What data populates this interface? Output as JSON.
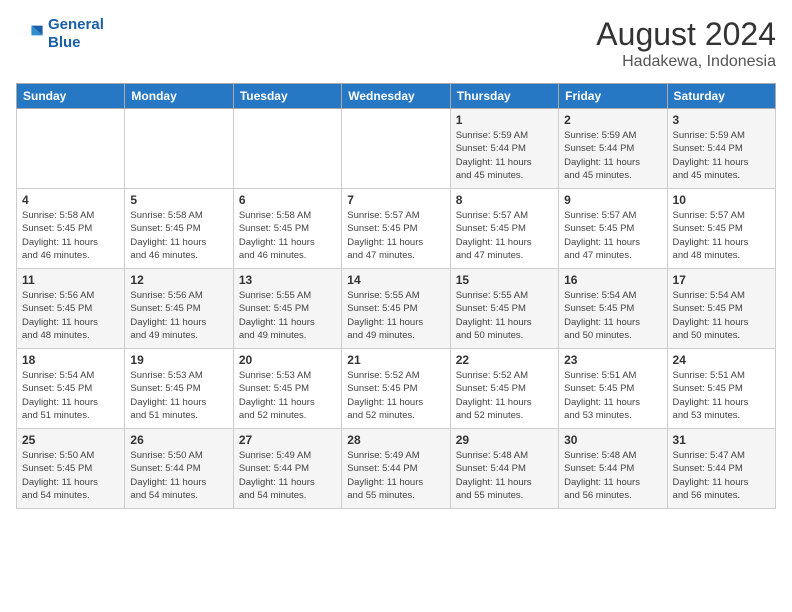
{
  "logo": {
    "line1": "General",
    "line2": "Blue"
  },
  "title": "August 2024",
  "subtitle": "Hadakewa, Indonesia",
  "days_of_week": [
    "Sunday",
    "Monday",
    "Tuesday",
    "Wednesday",
    "Thursday",
    "Friday",
    "Saturday"
  ],
  "weeks": [
    [
      {
        "day": "",
        "info": ""
      },
      {
        "day": "",
        "info": ""
      },
      {
        "day": "",
        "info": ""
      },
      {
        "day": "",
        "info": ""
      },
      {
        "day": "1",
        "info": "Sunrise: 5:59 AM\nSunset: 5:44 PM\nDaylight: 11 hours\nand 45 minutes."
      },
      {
        "day": "2",
        "info": "Sunrise: 5:59 AM\nSunset: 5:44 PM\nDaylight: 11 hours\nand 45 minutes."
      },
      {
        "day": "3",
        "info": "Sunrise: 5:59 AM\nSunset: 5:44 PM\nDaylight: 11 hours\nand 45 minutes."
      }
    ],
    [
      {
        "day": "4",
        "info": "Sunrise: 5:58 AM\nSunset: 5:45 PM\nDaylight: 11 hours\nand 46 minutes."
      },
      {
        "day": "5",
        "info": "Sunrise: 5:58 AM\nSunset: 5:45 PM\nDaylight: 11 hours\nand 46 minutes."
      },
      {
        "day": "6",
        "info": "Sunrise: 5:58 AM\nSunset: 5:45 PM\nDaylight: 11 hours\nand 46 minutes."
      },
      {
        "day": "7",
        "info": "Sunrise: 5:57 AM\nSunset: 5:45 PM\nDaylight: 11 hours\nand 47 minutes."
      },
      {
        "day": "8",
        "info": "Sunrise: 5:57 AM\nSunset: 5:45 PM\nDaylight: 11 hours\nand 47 minutes."
      },
      {
        "day": "9",
        "info": "Sunrise: 5:57 AM\nSunset: 5:45 PM\nDaylight: 11 hours\nand 47 minutes."
      },
      {
        "day": "10",
        "info": "Sunrise: 5:57 AM\nSunset: 5:45 PM\nDaylight: 11 hours\nand 48 minutes."
      }
    ],
    [
      {
        "day": "11",
        "info": "Sunrise: 5:56 AM\nSunset: 5:45 PM\nDaylight: 11 hours\nand 48 minutes."
      },
      {
        "day": "12",
        "info": "Sunrise: 5:56 AM\nSunset: 5:45 PM\nDaylight: 11 hours\nand 49 minutes."
      },
      {
        "day": "13",
        "info": "Sunrise: 5:55 AM\nSunset: 5:45 PM\nDaylight: 11 hours\nand 49 minutes."
      },
      {
        "day": "14",
        "info": "Sunrise: 5:55 AM\nSunset: 5:45 PM\nDaylight: 11 hours\nand 49 minutes."
      },
      {
        "day": "15",
        "info": "Sunrise: 5:55 AM\nSunset: 5:45 PM\nDaylight: 11 hours\nand 50 minutes."
      },
      {
        "day": "16",
        "info": "Sunrise: 5:54 AM\nSunset: 5:45 PM\nDaylight: 11 hours\nand 50 minutes."
      },
      {
        "day": "17",
        "info": "Sunrise: 5:54 AM\nSunset: 5:45 PM\nDaylight: 11 hours\nand 50 minutes."
      }
    ],
    [
      {
        "day": "18",
        "info": "Sunrise: 5:54 AM\nSunset: 5:45 PM\nDaylight: 11 hours\nand 51 minutes."
      },
      {
        "day": "19",
        "info": "Sunrise: 5:53 AM\nSunset: 5:45 PM\nDaylight: 11 hours\nand 51 minutes."
      },
      {
        "day": "20",
        "info": "Sunrise: 5:53 AM\nSunset: 5:45 PM\nDaylight: 11 hours\nand 52 minutes."
      },
      {
        "day": "21",
        "info": "Sunrise: 5:52 AM\nSunset: 5:45 PM\nDaylight: 11 hours\nand 52 minutes."
      },
      {
        "day": "22",
        "info": "Sunrise: 5:52 AM\nSunset: 5:45 PM\nDaylight: 11 hours\nand 52 minutes."
      },
      {
        "day": "23",
        "info": "Sunrise: 5:51 AM\nSunset: 5:45 PM\nDaylight: 11 hours\nand 53 minutes."
      },
      {
        "day": "24",
        "info": "Sunrise: 5:51 AM\nSunset: 5:45 PM\nDaylight: 11 hours\nand 53 minutes."
      }
    ],
    [
      {
        "day": "25",
        "info": "Sunrise: 5:50 AM\nSunset: 5:45 PM\nDaylight: 11 hours\nand 54 minutes."
      },
      {
        "day": "26",
        "info": "Sunrise: 5:50 AM\nSunset: 5:44 PM\nDaylight: 11 hours\nand 54 minutes."
      },
      {
        "day": "27",
        "info": "Sunrise: 5:49 AM\nSunset: 5:44 PM\nDaylight: 11 hours\nand 54 minutes."
      },
      {
        "day": "28",
        "info": "Sunrise: 5:49 AM\nSunset: 5:44 PM\nDaylight: 11 hours\nand 55 minutes."
      },
      {
        "day": "29",
        "info": "Sunrise: 5:48 AM\nSunset: 5:44 PM\nDaylight: 11 hours\nand 55 minutes."
      },
      {
        "day": "30",
        "info": "Sunrise: 5:48 AM\nSunset: 5:44 PM\nDaylight: 11 hours\nand 56 minutes."
      },
      {
        "day": "31",
        "info": "Sunrise: 5:47 AM\nSunset: 5:44 PM\nDaylight: 11 hours\nand 56 minutes."
      }
    ]
  ]
}
